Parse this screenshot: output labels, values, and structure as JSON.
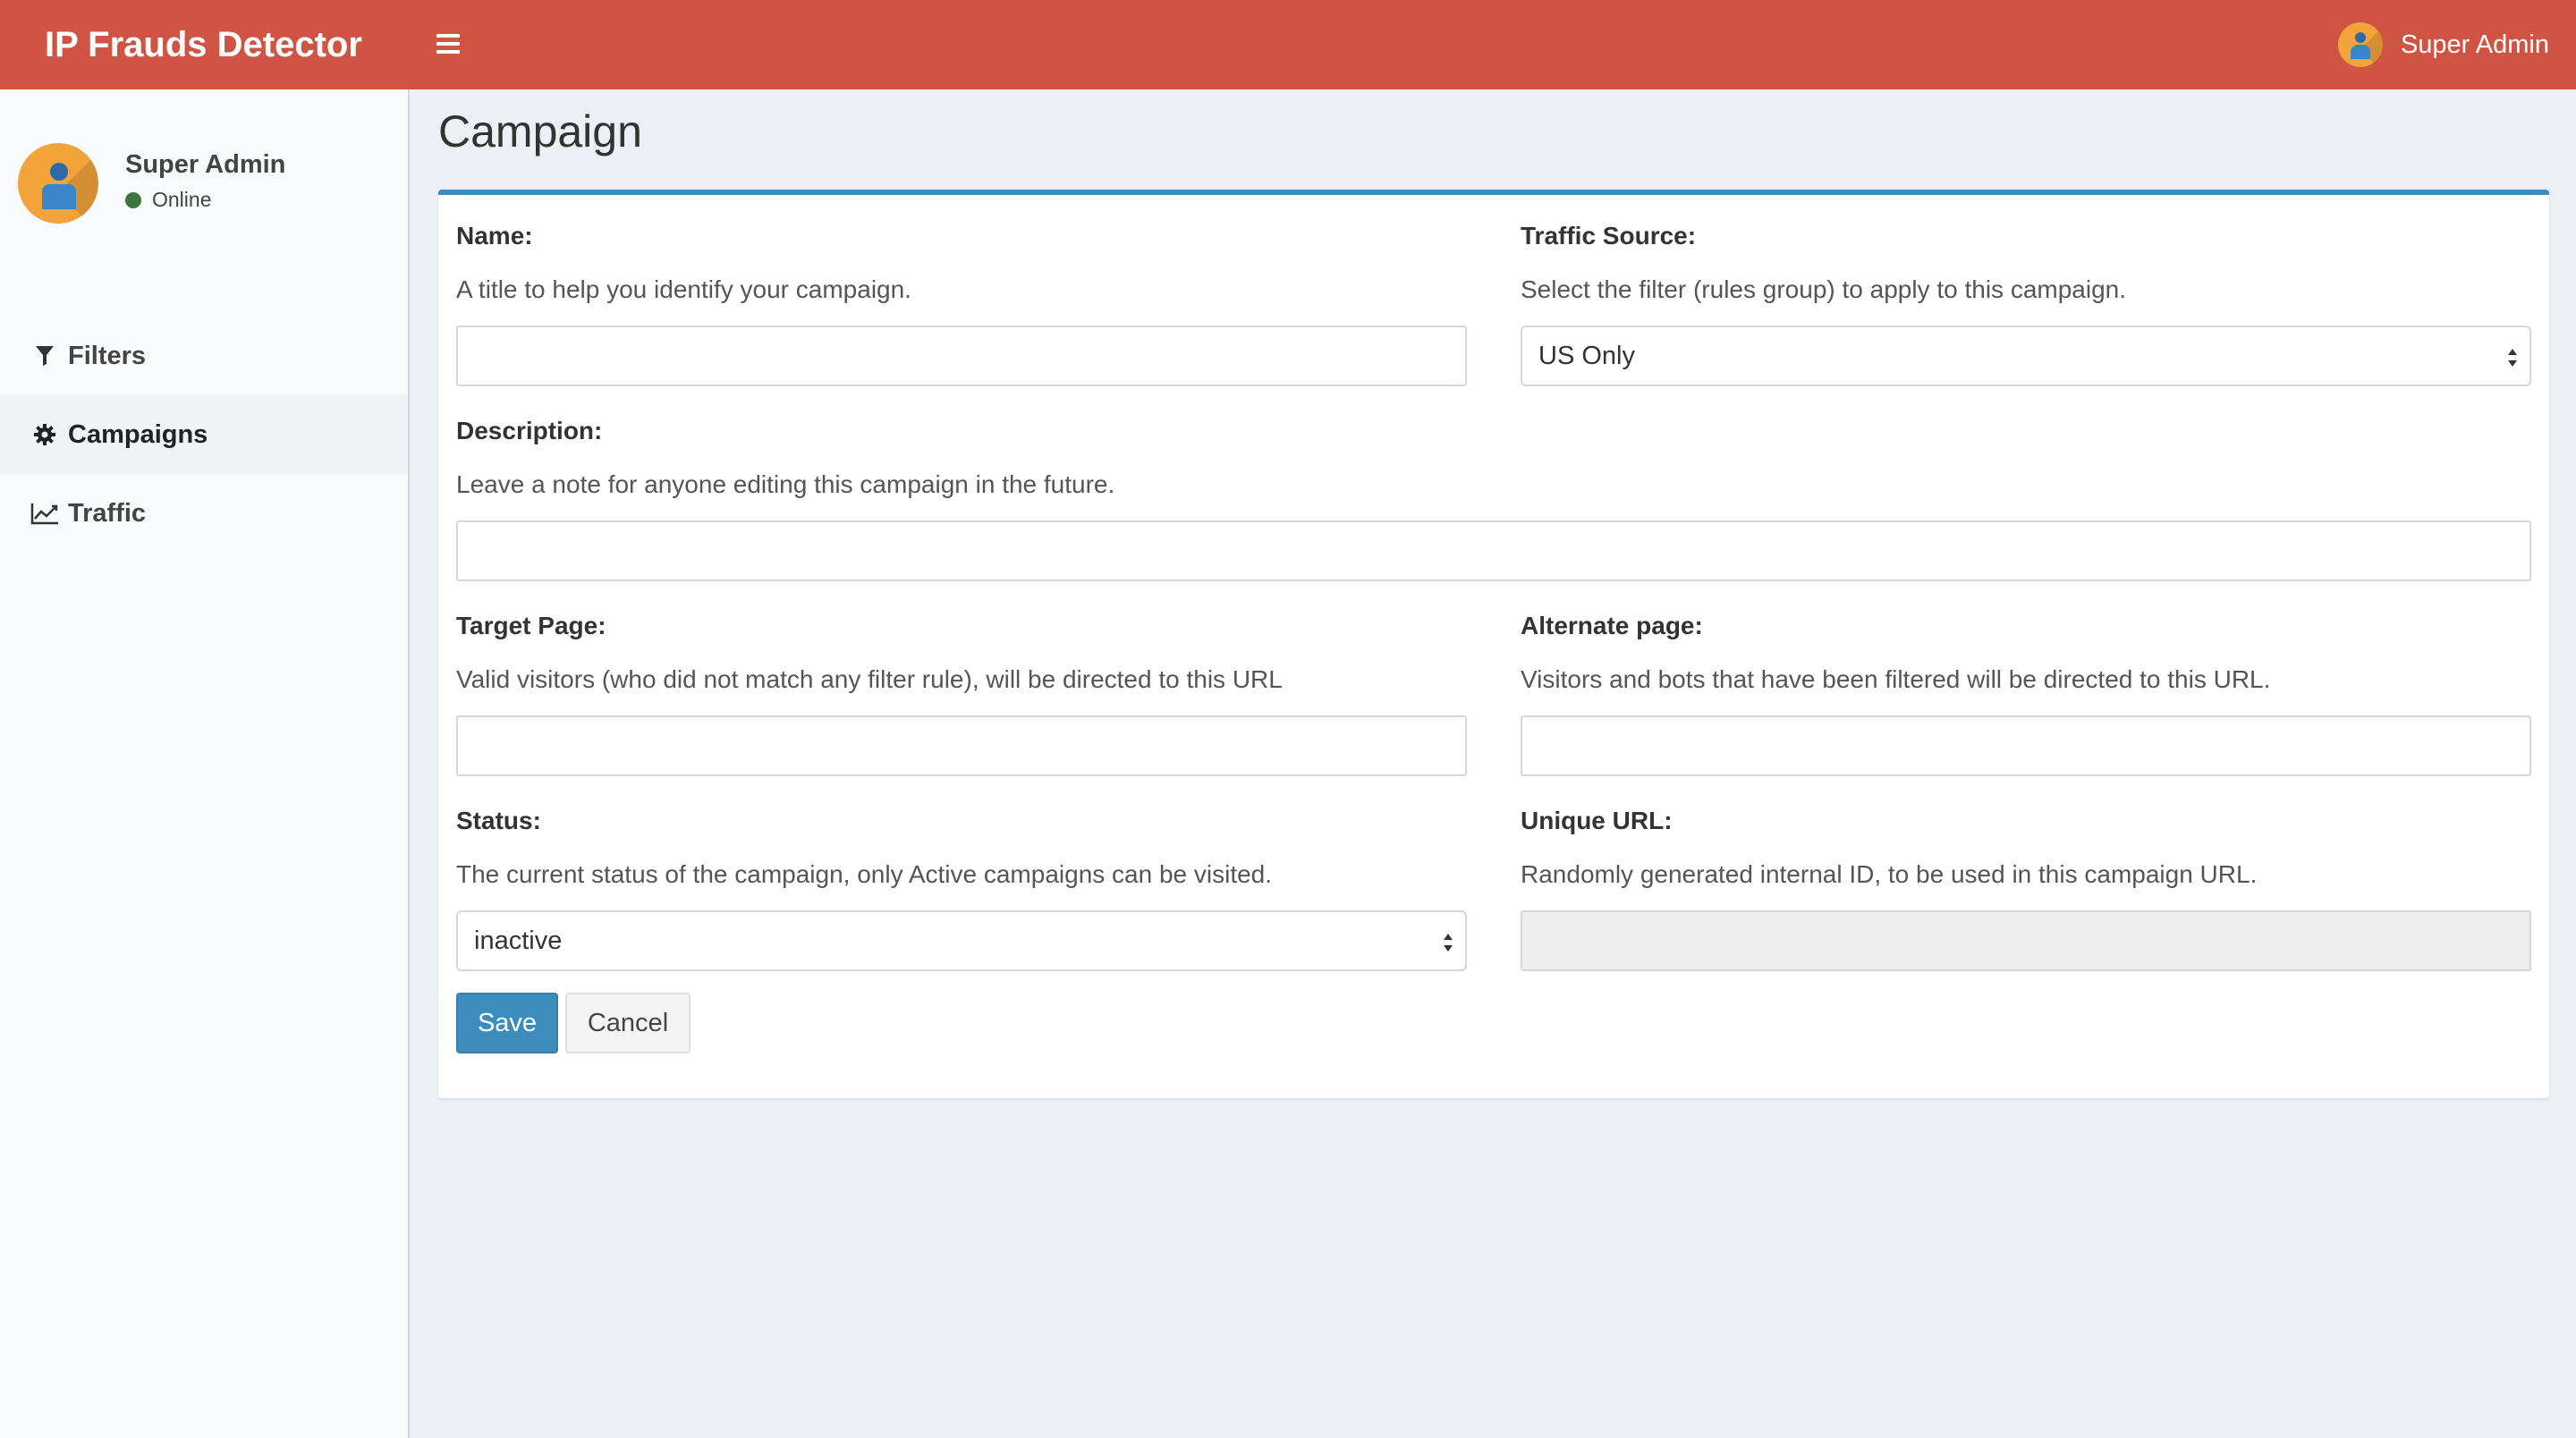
{
  "header": {
    "app_title": "IP Frauds Detector",
    "user_name": "Super Admin"
  },
  "sidebar": {
    "user": {
      "name": "Super Admin",
      "status": "Online"
    },
    "items": [
      {
        "label": "Filters",
        "icon": "filter-icon"
      },
      {
        "label": "Campaigns",
        "icon": "gear-icon",
        "active": true
      },
      {
        "label": "Traffic",
        "icon": "line-chart-icon"
      }
    ]
  },
  "page": {
    "title": "Campaign"
  },
  "form": {
    "name": {
      "label": "Name:",
      "help": "A title to help you identify your campaign.",
      "value": ""
    },
    "traffic_source": {
      "label": "Traffic Source:",
      "help": "Select the filter (rules group) to apply to this campaign.",
      "selected": "US Only"
    },
    "description": {
      "label": "Description:",
      "help": "Leave a note for anyone editing this campaign in the future.",
      "value": ""
    },
    "target_page": {
      "label": "Target Page:",
      "help": "Valid visitors (who did not match any filter rule), will be directed to this URL",
      "value": ""
    },
    "alternate_page": {
      "label": "Alternate page:",
      "help": "Visitors and bots that have been filtered will be directed to this URL.",
      "value": ""
    },
    "status": {
      "label": "Status:",
      "help": "The current status of the campaign, only Active campaigns can be visited.",
      "selected": "inactive"
    },
    "unique_url": {
      "label": "Unique URL:",
      "help": "Randomly generated internal ID, to be used in this campaign URL.",
      "value": ""
    },
    "save_label": "Save",
    "cancel_label": "Cancel"
  },
  "colors": {
    "header": "#d05443",
    "primary": "#3c8dbc",
    "avatar": "#f2a33a",
    "online": "#3c763d"
  }
}
